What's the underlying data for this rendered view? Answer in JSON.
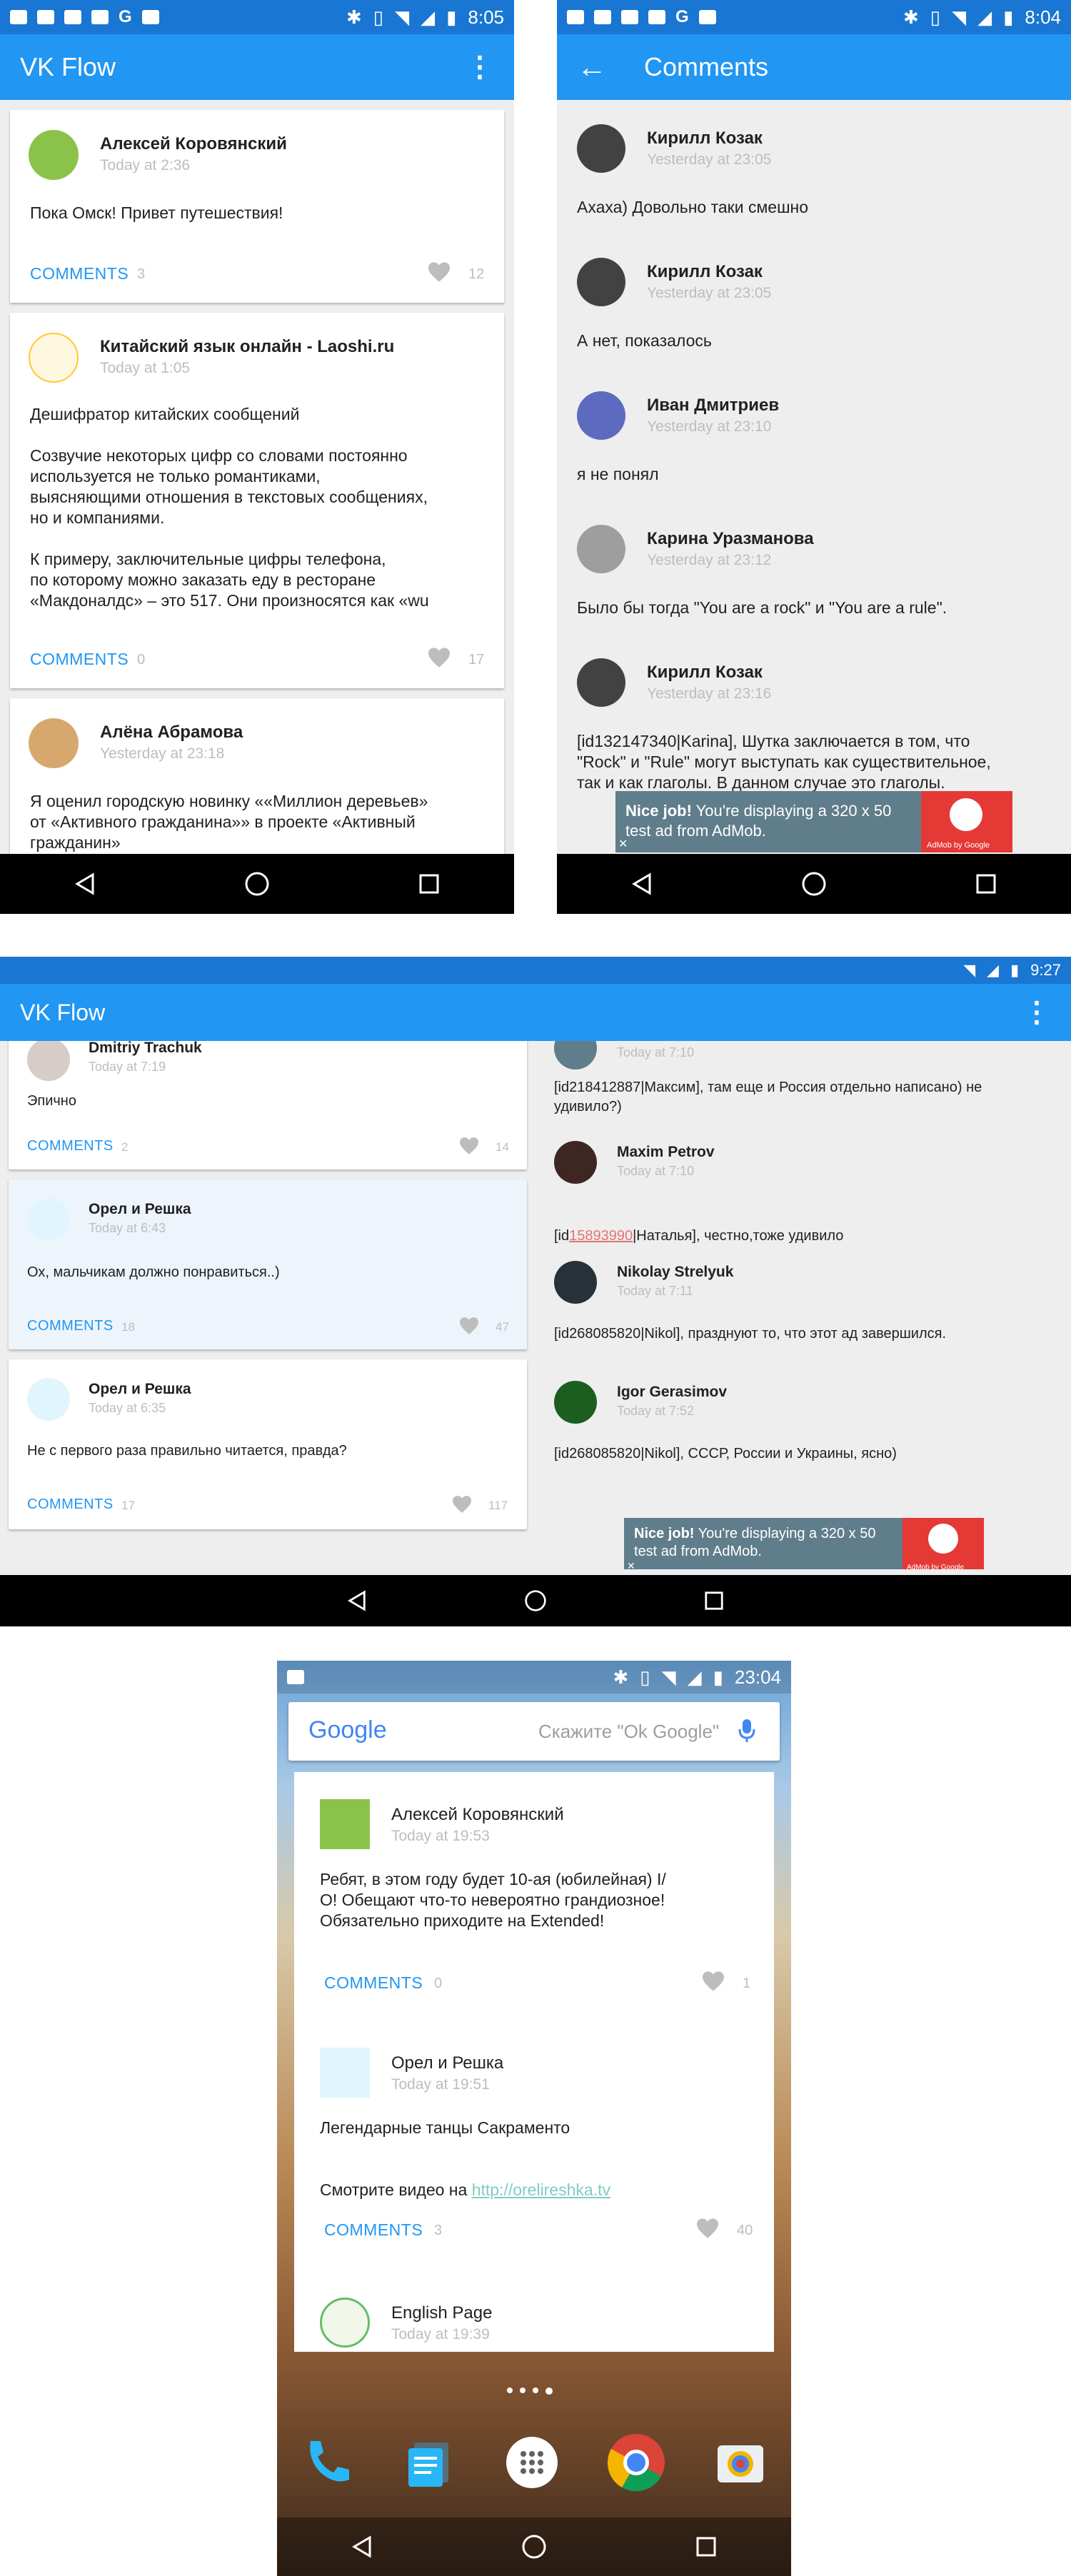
{
  "s1": {
    "clock": "8:05",
    "app_title": "VK Flow",
    "posts": [
      {
        "author": "Алексей Коровянский",
        "time": "Today at 2:36",
        "text": "Пока Омск! Привет путешествия!",
        "comments_label": "COMMENTS",
        "comments_count": "3",
        "likes": "12"
      },
      {
        "author": "Китайский язык онлайн - Laoshi.ru",
        "time": "Today at 1:05",
        "text": "Дешифратор китайских сообщений\n\nСозвучие некоторых цифр со словами постоянно\nиспользуется не только романтиками,\nвыясняющими отношения в текстовых сообщениях,\nно и компаниями.\n\nК примеру, заключительные цифры телефона,\nпо которому можно заказать еду в ресторане\n«Макдоналдс» – это 517. Они произносятся как «wu",
        "comments_label": "COMMENTS",
        "comments_count": "0",
        "likes": "17"
      },
      {
        "author": "Алёна Абрамова",
        "time": "Yesterday at 23:18",
        "text": "Я оценил городскую новинку ««Миллион деревьев»\nот «Активного гражданина»» в проекте «Активный\nгражданин»"
      }
    ]
  },
  "s2": {
    "clock": "8:04",
    "title": "Comments",
    "comments": [
      {
        "author": "Кирилл Козак",
        "time": "Yesterday at 23:05",
        "text": "Ахаха) Довольно таки смешно"
      },
      {
        "author": "Кирилл Козак",
        "time": "Yesterday at 23:05",
        "text": "А нет, показалось"
      },
      {
        "author": "Иван Дмитриев",
        "time": "Yesterday at 23:10",
        "text": "я не понял"
      },
      {
        "author": "Карина Уразманова",
        "time": "Yesterday at 23:12",
        "text": "Было бы тогда \"You are a rock\" и \"You are a rule\"."
      },
      {
        "author": "Кирилл Козак",
        "time": "Yesterday at 23:16",
        "text": "[id132147340|Karina], Шутка заключается в том, что\n\"Rock\" и \"Rule\" могут выступать как существительное,\nтак и как глаголы. В данном случае это глаголы."
      }
    ],
    "ad": {
      "bold": "Nice job!",
      "line1": " You're displaying a 320 x 50",
      "line2": "test ad from AdMob.",
      "logo": "AdMob by Google",
      "close": "✕"
    }
  },
  "s3": {
    "clock": "9:27",
    "app_title": "VK Flow",
    "posts": [
      {
        "author": "Dmitriy Trachuk",
        "time": "Today at 7:19",
        "text": "Эпично",
        "comments_label": "COMMENTS",
        "comments_count": "2",
        "likes": "14"
      },
      {
        "author": "Орел и Решка",
        "time": "Today at 6:43",
        "text": "Ох, мальчикам должно понравиться..)",
        "comments_label": "COMMENTS",
        "comments_count": "18",
        "likes": "47"
      },
      {
        "author": "Орел и Решка",
        "time": "Today at 6:35",
        "text": "Не с первого раза правильно читается, правда?",
        "comments_label": "COMMENTS",
        "comments_count": "17",
        "likes": "117"
      }
    ],
    "comments": [
      {
        "time": "Today at 7:10",
        "text": "[id218412887|Максим], там еще и Россия отдельно написано) не\nудивило?)"
      },
      {
        "author": "Maxim Petrov",
        "time": "Today at 7:10",
        "text_pre": "[id",
        "text_link": "15893990",
        "text_post": "|Наталья], честно,тоже удивило"
      },
      {
        "author": "Nikolay Strelyuk",
        "time": "Today at 7:11",
        "text": "[id268085820|Nikol], празднуют то, что этот ад завершился."
      },
      {
        "author": "Igor Gerasimov",
        "time": "Today at 7:52",
        "text": "[id268085820|Nikol], СССР, России и Украины, ясно)"
      }
    ],
    "ad": {
      "bold": "Nice job!",
      "line1": " You're displaying a 320 x 50",
      "line2": "test ad from AdMob.",
      "logo": "AdMob by Google",
      "close": "✕"
    }
  },
  "s4": {
    "clock": "23:04",
    "search_placeholder": "Скажите \"Ok Google\"",
    "google_logo": "Google",
    "posts": [
      {
        "author": "Алексей Коровянский",
        "time": "Today at 19:53",
        "text": "Ребят, в этом году будет 10-ая (юбилейная) I/\nO! Обещают что-то невероятно грандиозное!\nОбязательно приходите на Extended!",
        "comments_label": "COMMENTS",
        "comments_count": "0",
        "likes": "1"
      },
      {
        "author": "Орел и Решка",
        "time": "Today at 19:51",
        "text": "Легендарные танцы Сакраменто",
        "text2": "Смотрите видео на ",
        "link": "http://orelireshka.tv",
        "comments_label": "COMMENTS",
        "comments_count": "3",
        "likes": "40"
      },
      {
        "author": "English Page",
        "time": "Today at 19:39"
      }
    ]
  },
  "colors": {
    "primary": "#2196f3",
    "primary_dark": "#1976d2",
    "accent": "#2196f3",
    "ad_bg": "#607d8b"
  }
}
